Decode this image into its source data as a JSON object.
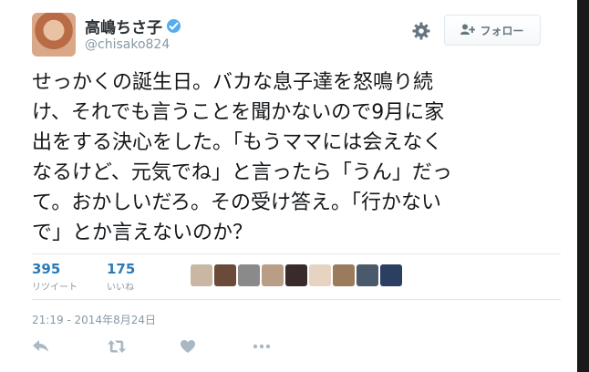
{
  "user": {
    "display_name": "高嶋ちさ子",
    "screen_name": "@chisako824",
    "verified": true
  },
  "header": {
    "settings_icon": "gear-icon",
    "follow_label": "フォロー",
    "follow_icon": "add-user-icon"
  },
  "tweet": {
    "lines": [
      "せっかくの誕生日。バカな息子達を怒鳴り続",
      "け、それでも言うことを聞かないので9月に家",
      "出をする決心をした。「もうママには会えなく",
      "なるけど、元気でね」と言ったら「うん」だっ",
      "て。おかしいだろ。その受け答え。「行かない",
      "で」とか言えないのか？"
    ]
  },
  "stats": {
    "retweets": {
      "count": "395",
      "label": "リツイート"
    },
    "likes": {
      "count": "175",
      "label": "いいね"
    }
  },
  "likers": [
    {
      "color": "#c9b7a3"
    },
    {
      "color": "#6b4a3a"
    },
    {
      "color": "#8a8a8a"
    },
    {
      "color": "#b99e86"
    },
    {
      "color": "#3b2a2a"
    },
    {
      "color": "#e6d3c2"
    },
    {
      "color": "#9a7b5c"
    },
    {
      "color": "#4a5a6a"
    },
    {
      "color": "#2b3f63"
    }
  ],
  "timestamp": "21:19 - 2014年8月24日",
  "actions": [
    "reply-icon",
    "retweet-icon",
    "like-icon",
    "more-icon"
  ],
  "colors": {
    "link": "#2b7bb9",
    "muted": "#8899a6",
    "verified": "#55acee",
    "text": "#14171a"
  }
}
